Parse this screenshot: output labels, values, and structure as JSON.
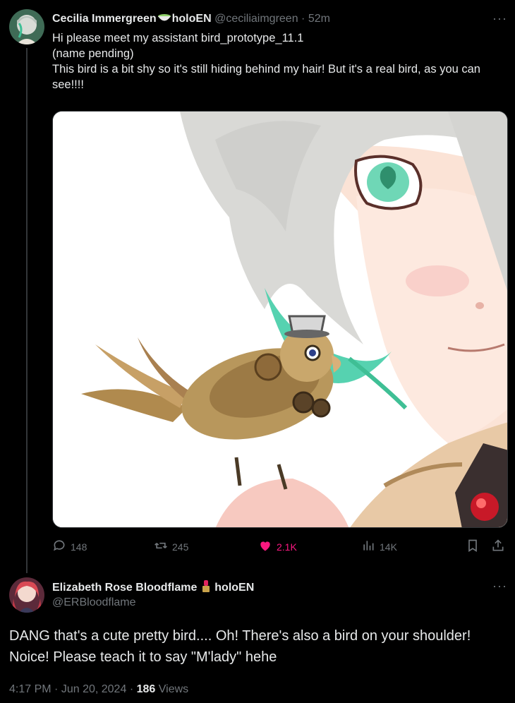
{
  "tweet": {
    "author_name": "Cecilia Immergreen",
    "org": "holoEN",
    "handle": "@ceciliaimgreen",
    "time": "52m",
    "more": "···",
    "text": "Hi please meet my assistant bird_prototype_11.1\n(name pending)\nThis bird is a bit shy so it's still hiding behind my hair! But it's a real bird, as you can see!!!!",
    "stats": {
      "replies": "148",
      "reposts": "245",
      "likes": "2.1K",
      "views": "14K"
    },
    "icons": {
      "reply": "reply-icon",
      "repost": "repost-icon",
      "like": "heart-icon",
      "views": "views-icon",
      "bookmark": "bookmark-icon",
      "share": "share-icon",
      "badge": "matcha-bowl-icon"
    }
  },
  "reply": {
    "author_name": "Elizabeth Rose Bloodflame",
    "org": "holoEN",
    "handle": "@ERBloodflame",
    "more": "···",
    "text": "DANG that's a cute pretty bird.... Oh! There's also a bird on your shoulder!\nNoice! Please teach it to say \"M'lady\" hehe",
    "badge_icon": "lipstick-icon",
    "meta": {
      "time": "4:17 PM",
      "date": "Jun 20, 2024",
      "views_count": "186",
      "views_label": "Views"
    }
  },
  "colors": {
    "background": "#000000",
    "text": "#e7e9ea",
    "muted": "#71767b",
    "like": "#f91880"
  }
}
